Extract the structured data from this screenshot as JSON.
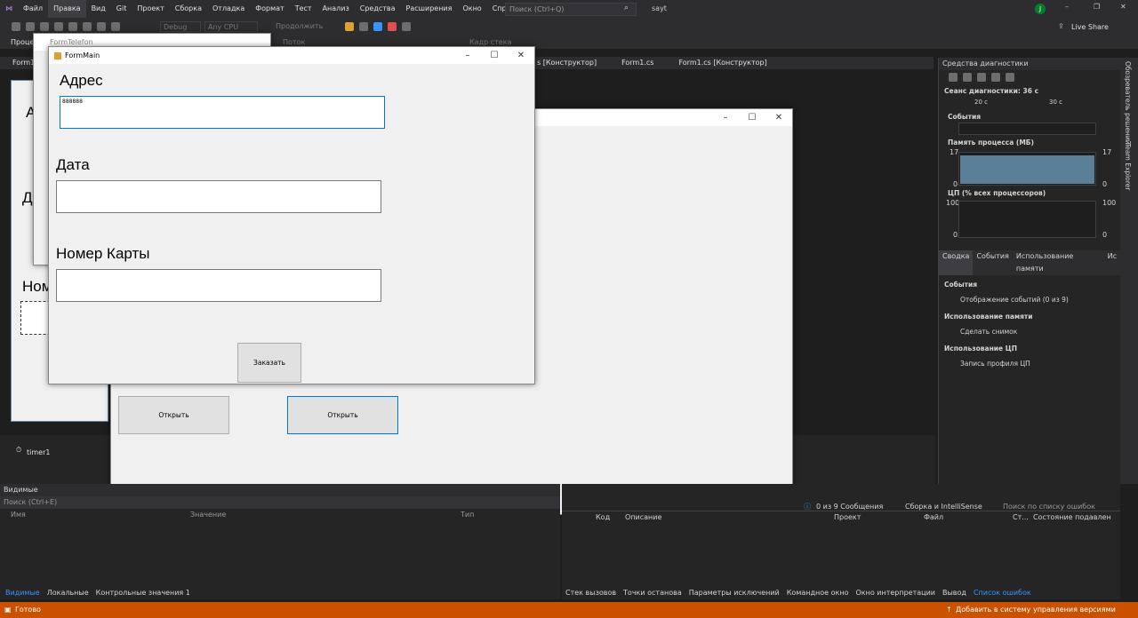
{
  "menu": [
    "Файл",
    "Правка",
    "Вид",
    "Git",
    "Проект",
    "Сборка",
    "Отладка",
    "Формат",
    "Тест",
    "Анализ",
    "Средства",
    "Расширения",
    "Окно",
    "Справка"
  ],
  "search_placeholder": "Поиск (Ctrl+Q)",
  "solution": "sayt",
  "user_initial": "J",
  "liveshare": "Live Share",
  "config": "Debug",
  "platform": "Any CPU",
  "continue": "Продолжить",
  "process_label": "Процесс",
  "thread_label": "Поток",
  "stack_label": "Кадр стека",
  "doctabs": [
    "s [Конструктор]",
    "Form1.cs",
    "Form1.cs [Конструктор]"
  ],
  "diag": {
    "title": "Средства диагностики",
    "session": "Сеанс диагностики: 36 с",
    "t20": "20 с",
    "t30": "30 с",
    "events": "События",
    "memory": "Память процесса (МБ)",
    "mem_max": "17",
    "mem_min": "0",
    "cpu": "ЦП (% всех процессоров)",
    "cpu_max": "100",
    "cpu_min": "0",
    "tabs": [
      "Сводка",
      "События",
      "Использование памяти",
      "Ис"
    ],
    "sec_events": "События",
    "events_item": "Отображение событий (0 из 9)",
    "sec_mem": "Использование памяти",
    "mem_item": "Сделать снимок",
    "sec_cpu": "Использование ЦП",
    "cpu_item": "Запись профиля ЦП"
  },
  "side": {
    "explorer": "Обозреватель решений",
    "team": "Team Explorer"
  },
  "timer": "timer1",
  "locals": {
    "title": "Видимые",
    "search": "Поиск (Ctrl+E)",
    "cols": [
      "Имя",
      "Значение",
      "Тип"
    ],
    "tabs": [
      "Видимые",
      "Локальные",
      "Контрольные значения 1"
    ]
  },
  "errors": {
    "messages": "0 из 9 Сообщения",
    "build": "Сборка и IntelliSense",
    "search": "Поиск по списку ошибок",
    "cols": [
      "Код",
      "Описание",
      "Проект",
      "Файл",
      "Ст...",
      "Состояние подавлен"
    ],
    "tabs": [
      "Стек вызовов",
      "Точки останова",
      "Параметры исключений",
      "Командное окно",
      "Окно интерпретации",
      "Вывод",
      "Список ошибок"
    ]
  },
  "status": {
    "ready": "Готово",
    "vcs": "Добавить в систему управления версиями"
  },
  "form_telefon": {
    "title": "FormTelefon"
  },
  "form_main": {
    "title": "FormMain",
    "address_label": "Адрес",
    "address_value": "888888",
    "date_label": "Дата",
    "card_label": "Номер Карты",
    "order_button": "Заказать"
  },
  "designer_labels": {
    "a": "А",
    "d": "Д",
    "nom": "Ном"
  },
  "form1": {
    "open1": "Открыть",
    "open2": "Открыть"
  }
}
